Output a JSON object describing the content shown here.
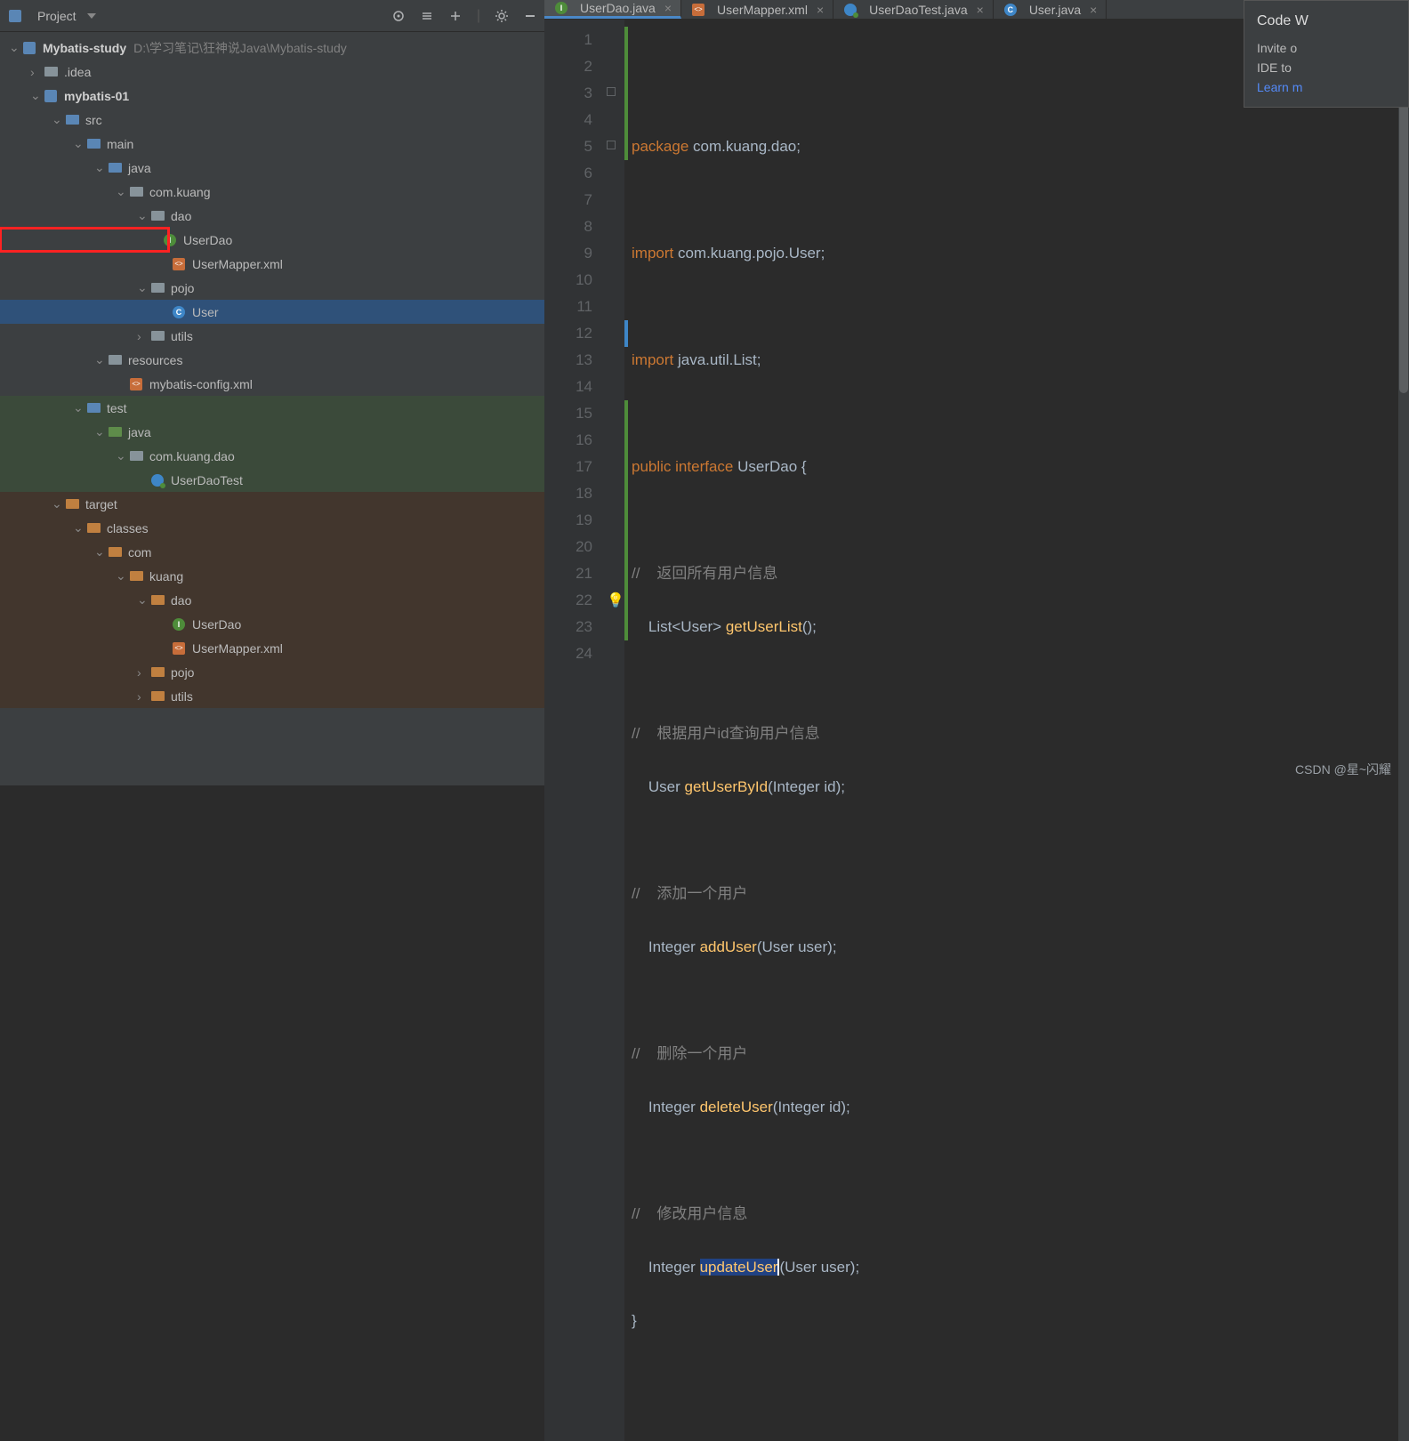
{
  "project": {
    "header": "Project",
    "root_name": "Mybatis-study",
    "root_path": "D:\\学习笔记\\狂神说Java\\Mybatis-study"
  },
  "tree": {
    "idea": ".idea",
    "mybatis01": "mybatis-01",
    "src": "src",
    "main": "main",
    "java": "java",
    "comkuang": "com.kuang",
    "dao": "dao",
    "userdao": "UserDao",
    "usermapper": "UserMapper.xml",
    "pojo": "pojo",
    "user": "User",
    "utils": "utils",
    "resources": "resources",
    "mybatisconfig": "mybatis-config.xml",
    "test": "test",
    "java2": "java",
    "comkuangdao": "com.kuang.dao",
    "userdaotest": "UserDaoTest",
    "target": "target",
    "classes": "classes",
    "com": "com",
    "kuang": "kuang",
    "dao2": "dao",
    "userdao2": "UserDao",
    "usermapper2": "UserMapper.xml",
    "pojo2": "pojo",
    "utils2": "utils"
  },
  "tabs": [
    {
      "label": "UserDao.java",
      "icon": "I",
      "active": true
    },
    {
      "label": "UserMapper.xml",
      "icon": "X",
      "active": false
    },
    {
      "label": "UserDaoTest.java",
      "icon": "T",
      "active": false
    },
    {
      "label": "User.java",
      "icon": "C",
      "active": false
    }
  ],
  "sidepanel": {
    "title": "Code W",
    "line1": "Invite o",
    "line2": "IDE to ",
    "link": "Learn m"
  },
  "watermark": "CSDN @星~闪耀",
  "code": {
    "l1": {
      "kw": "package",
      "rest": " com.kuang.dao;"
    },
    "l3": {
      "kw": "import",
      "rest": " com.kuang.pojo.User;"
    },
    "l5": {
      "kw": "import",
      "rest": " java.util.List;"
    },
    "l7": {
      "kw1": "public",
      "kw2": "interface",
      "name": "UserDao",
      "brace": " {"
    },
    "l9": {
      "com": "//    返回所有用户信息"
    },
    "l10": {
      "ret": "List<User> ",
      "fn": "getUserList",
      "tail": "();"
    },
    "l12": {
      "com": "//    根据用户id查询用户信息"
    },
    "l13": {
      "ret": "User ",
      "fn": "getUserById",
      "tail": "(Integer id);"
    },
    "l15": {
      "com": "//    添加一个用户"
    },
    "l16": {
      "ret": "Integer ",
      "fn": "addUser",
      "tail": "(User user);"
    },
    "l18": {
      "com": "//    删除一个用户"
    },
    "l19": {
      "ret": "Integer ",
      "fn": "deleteUser",
      "tail": "(Integer id);"
    },
    "l21": {
      "com": "//    修改用户信息"
    },
    "l22": {
      "ret": "Integer ",
      "fn": "updateUser",
      "tail": "(User user);"
    },
    "l23": {
      "brace": "}"
    }
  }
}
